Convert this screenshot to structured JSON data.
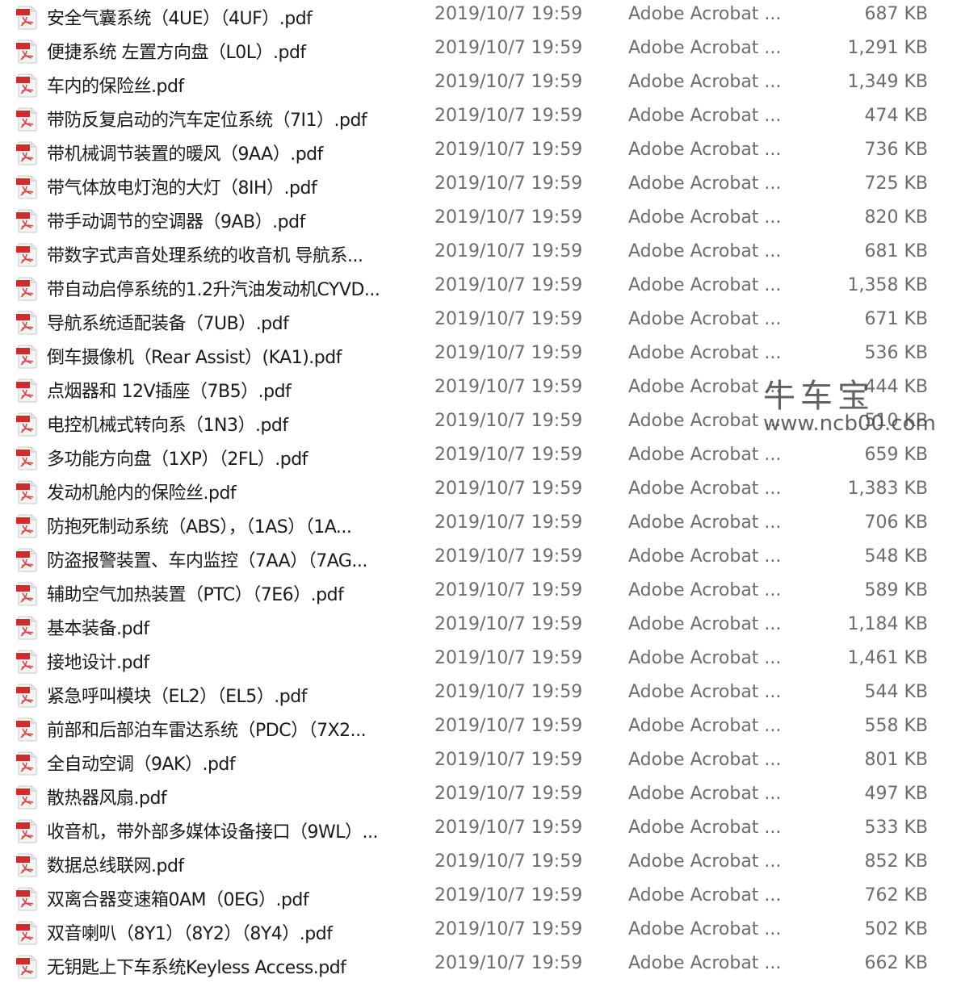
{
  "colors": {
    "pdf_icon": "#d32a2a",
    "name_text": "#1a1a1a",
    "meta_text": "#6d6d6d"
  },
  "files": [
    {
      "name": "安全气囊系统（4UE）（4UF）.pdf",
      "date": "2019/10/7 19:59",
      "type": "Adobe Acrobat ...",
      "size": "687 KB"
    },
    {
      "name": "便捷系统 左置方向盘（L0L）.pdf",
      "date": "2019/10/7 19:59",
      "type": "Adobe Acrobat ...",
      "size": "1,291 KB"
    },
    {
      "name": "车内的保险丝.pdf",
      "date": "2019/10/7 19:59",
      "type": "Adobe Acrobat ...",
      "size": "1,349 KB"
    },
    {
      "name": "带防反复启动的汽车定位系统（7I1）.pdf",
      "date": "2019/10/7 19:59",
      "type": "Adobe Acrobat ...",
      "size": "474 KB"
    },
    {
      "name": "带机械调节装置的暖风（9AA）.pdf",
      "date": "2019/10/7 19:59",
      "type": "Adobe Acrobat ...",
      "size": "736 KB"
    },
    {
      "name": "带气体放电灯泡的大灯（8IH）.pdf",
      "date": "2019/10/7 19:59",
      "type": "Adobe Acrobat ...",
      "size": "725 KB"
    },
    {
      "name": "带手动调节的空调器（9AB）.pdf",
      "date": "2019/10/7 19:59",
      "type": "Adobe Acrobat ...",
      "size": "820 KB"
    },
    {
      "name": "带数字式声音处理系统的收音机 导航系...",
      "date": "2019/10/7 19:59",
      "type": "Adobe Acrobat ...",
      "size": "681 KB"
    },
    {
      "name": "带自动启停系统的1.2升汽油发动机CYVD...",
      "date": "2019/10/7 19:59",
      "type": "Adobe Acrobat ...",
      "size": "1,358 KB"
    },
    {
      "name": "导航系统适配装备（7UB）.pdf",
      "date": "2019/10/7 19:59",
      "type": "Adobe Acrobat ...",
      "size": "671 KB"
    },
    {
      "name": "倒车摄像机（Rear Assist）(KA1).pdf",
      "date": "2019/10/7 19:59",
      "type": "Adobe Acrobat ...",
      "size": "536 KB"
    },
    {
      "name": "点烟器和 12V插座（7B5）.pdf",
      "date": "2019/10/7 19:59",
      "type": "Adobe Acrobat ...",
      "size": "444 KB"
    },
    {
      "name": "电控机械式转向系（1N3）.pdf",
      "date": "2019/10/7 19:59",
      "type": "Adobe Acrobat ...",
      "size": "510 KB"
    },
    {
      "name": "多功能方向盘（1XP）（2FL）.pdf",
      "date": "2019/10/7 19:59",
      "type": "Adobe Acrobat ...",
      "size": "659 KB"
    },
    {
      "name": "发动机舱内的保险丝.pdf",
      "date": "2019/10/7 19:59",
      "type": "Adobe Acrobat ...",
      "size": "1,383 KB"
    },
    {
      "name": "防抱死制动系统（ABS），（1AS）（1A...",
      "date": "2019/10/7 19:59",
      "type": "Adobe Acrobat ...",
      "size": "706 KB"
    },
    {
      "name": "防盗报警装置、车内监控（7AA）（7AG...",
      "date": "2019/10/7 19:59",
      "type": "Adobe Acrobat ...",
      "size": "548 KB"
    },
    {
      "name": "辅助空气加热装置（PTC）（7E6）.pdf",
      "date": "2019/10/7 19:59",
      "type": "Adobe Acrobat ...",
      "size": "589 KB"
    },
    {
      "name": "基本装备.pdf",
      "date": "2019/10/7 19:59",
      "type": "Adobe Acrobat ...",
      "size": "1,184 KB"
    },
    {
      "name": "接地设计.pdf",
      "date": "2019/10/7 19:59",
      "type": "Adobe Acrobat ...",
      "size": "1,461 KB"
    },
    {
      "name": "紧急呼叫模块（EL2）（EL5）.pdf",
      "date": "2019/10/7 19:59",
      "type": "Adobe Acrobat ...",
      "size": "544 KB"
    },
    {
      "name": "前部和后部泊车雷达系统（PDC）（7X2...",
      "date": "2019/10/7 19:59",
      "type": "Adobe Acrobat ...",
      "size": "558 KB"
    },
    {
      "name": "全自动空调（9AK）.pdf",
      "date": "2019/10/7 19:59",
      "type": "Adobe Acrobat ...",
      "size": "801 KB"
    },
    {
      "name": "散热器风扇.pdf",
      "date": "2019/10/7 19:59",
      "type": "Adobe Acrobat ...",
      "size": "497 KB"
    },
    {
      "name": "收音机，带外部多媒体设备接口（9WL）...",
      "date": "2019/10/7 19:59",
      "type": "Adobe Acrobat ...",
      "size": "533 KB"
    },
    {
      "name": "数据总线联网.pdf",
      "date": "2019/10/7 19:59",
      "type": "Adobe Acrobat ...",
      "size": "852 KB"
    },
    {
      "name": "双离合器变速箱0AM（0EG）.pdf",
      "date": "2019/10/7 19:59",
      "type": "Adobe Acrobat ...",
      "size": "762 KB"
    },
    {
      "name": "双音喇叭（8Y1）（8Y2）（8Y4）.pdf",
      "date": "2019/10/7 19:59",
      "type": "Adobe Acrobat ...",
      "size": "502 KB"
    },
    {
      "name": "无钥匙上下车系统Keyless Access.pdf",
      "date": "2019/10/7 19:59",
      "type": "Adobe Acrobat ...",
      "size": "662 KB"
    }
  ],
  "watermark": {
    "title": "牛车宝",
    "url": "www.ncb00.com"
  }
}
